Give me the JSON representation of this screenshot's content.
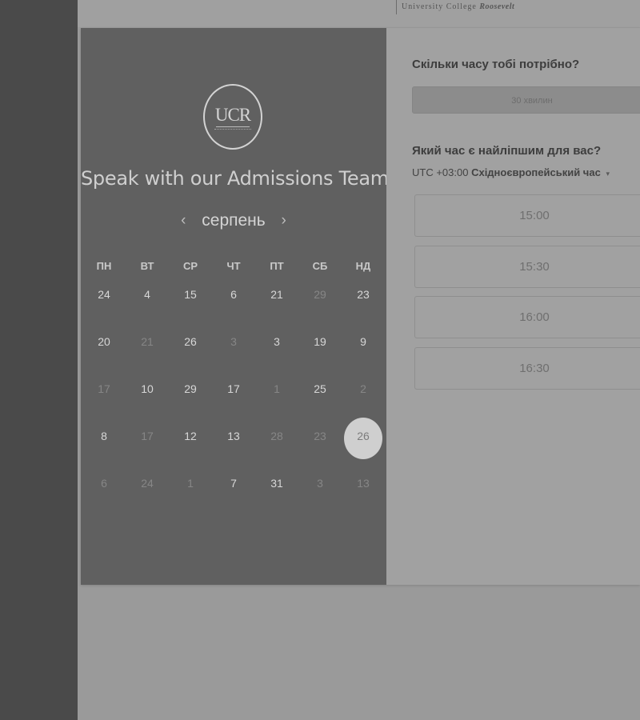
{
  "header": {
    "logo_text": "University College",
    "logo_italic": "Roosevelt"
  },
  "calendar": {
    "logo_text": "UCR",
    "title": "Speak with our Admissions Team",
    "month": "серпень",
    "prev_icon": "chevron-left-icon",
    "next_icon": "chevron-right-icon",
    "weekdays": [
      "ПН",
      "ВТ",
      "СР",
      "ЧТ",
      "ПТ",
      "СБ",
      "НД"
    ],
    "weeks": [
      [
        {
          "d": "24",
          "m": false
        },
        {
          "d": "4",
          "m": false
        },
        {
          "d": "15",
          "m": false
        },
        {
          "d": "6",
          "m": false
        },
        {
          "d": "21",
          "m": false
        },
        {
          "d": "29",
          "m": true
        },
        {
          "d": "23",
          "m": false
        }
      ],
      [
        {
          "d": "20",
          "m": false
        },
        {
          "d": "21",
          "m": true
        },
        {
          "d": "26",
          "m": false
        },
        {
          "d": "3",
          "m": true
        },
        {
          "d": "3",
          "m": false
        },
        {
          "d": "19",
          "m": false
        },
        {
          "d": "9",
          "m": false
        }
      ],
      [
        {
          "d": "17",
          "m": true
        },
        {
          "d": "10",
          "m": false
        },
        {
          "d": "29",
          "m": false
        },
        {
          "d": "17",
          "m": false
        },
        {
          "d": "1",
          "m": true
        },
        {
          "d": "25",
          "m": false
        },
        {
          "d": "2",
          "m": true
        }
      ],
      [
        {
          "d": "8",
          "m": false
        },
        {
          "d": "17",
          "m": true
        },
        {
          "d": "12",
          "m": false
        },
        {
          "d": "13",
          "m": false
        },
        {
          "d": "28",
          "m": true
        },
        {
          "d": "23",
          "m": true
        },
        {
          "d": "26",
          "m": false,
          "selected": true
        }
      ],
      [
        {
          "d": "6",
          "m": true
        },
        {
          "d": "24",
          "m": true
        },
        {
          "d": "1",
          "m": true
        },
        {
          "d": "7",
          "m": false
        },
        {
          "d": "31",
          "m": false
        },
        {
          "d": "3",
          "m": true
        },
        {
          "d": "13",
          "m": true
        }
      ]
    ]
  },
  "booking": {
    "duration_question": "Скільки часу тобі потрібно?",
    "duration_value": "30 хвилин",
    "time_question": "Який час є найліпшим для вас?",
    "timezone_offset": "UTC +03:00",
    "timezone_name": "Східноєвропейський час",
    "timezone_caret": "▾",
    "slots": [
      "15:00",
      "15:30",
      "16:00",
      "16:30"
    ]
  },
  "colors": {
    "panel_dark": "#606060",
    "panel_light": "#a1a1a1",
    "selected_day": "#cfcfcf"
  }
}
